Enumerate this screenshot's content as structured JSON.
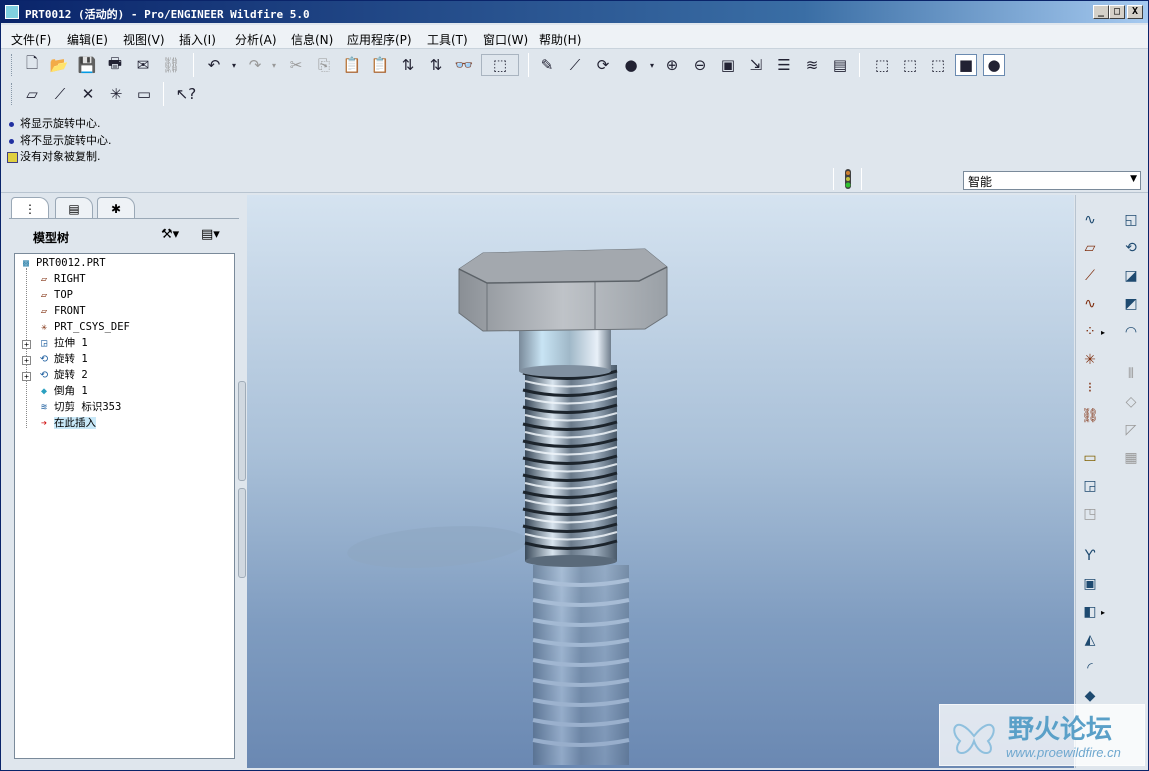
{
  "window": {
    "title": "PRT0012 (活动的) - Pro/ENGINEER Wildfire 5.0",
    "controls": {
      "minimize": "_",
      "maximize": "□",
      "close": "X"
    }
  },
  "menu": [
    "文件(F)",
    "编辑(E)",
    "视图(V)",
    "插入(I)",
    "分析(A)",
    "信息(N)",
    "应用程序(P)",
    "工具(T)",
    "窗口(W)",
    "帮助(H)"
  ],
  "messages": [
    "将显示旋转中心.",
    "将不显示旋转中心.",
    "没有对象被复制."
  ],
  "selection_filter": {
    "value": "智能"
  },
  "navigator": {
    "header": "模型树",
    "tree": [
      {
        "label": "PRT0012.PRT",
        "icon": "part-icon"
      },
      {
        "label": "RIGHT",
        "icon": "datum-plane-icon"
      },
      {
        "label": "TOP",
        "icon": "datum-plane-icon"
      },
      {
        "label": "FRONT",
        "icon": "datum-plane-icon"
      },
      {
        "label": "PRT_CSYS_DEF",
        "icon": "csys-icon"
      },
      {
        "label": "拉伸 1",
        "icon": "extrude-icon"
      },
      {
        "label": "旋转 1",
        "icon": "revolve-icon"
      },
      {
        "label": "旋转 2",
        "icon": "revolve-icon"
      },
      {
        "label": "倒角 1",
        "icon": "chamfer-icon"
      },
      {
        "label": "切剪 标识353",
        "icon": "cut-icon"
      },
      {
        "label": "在此插入",
        "icon": "insert-here-icon"
      }
    ]
  },
  "watermark": {
    "title": "野火论坛",
    "url": "www.proewildfire.cn"
  },
  "colors": {
    "title_bar": "#0a246a",
    "graphics_top": "#d5e3f0",
    "graphics_bottom": "#6a88b2"
  }
}
